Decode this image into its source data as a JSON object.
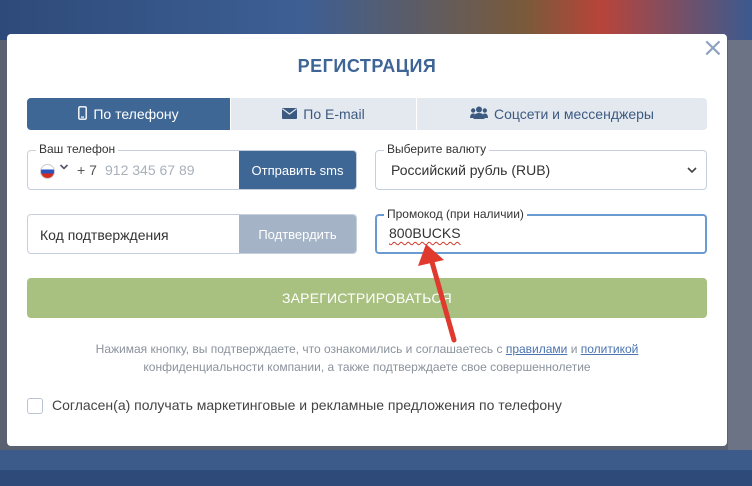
{
  "modal": {
    "title": "РЕГИСТРАЦИЯ",
    "close_icon": "close-icon"
  },
  "tabs": [
    {
      "label": "По телефону",
      "icon": "phone-icon",
      "active": true
    },
    {
      "label": "По E-mail",
      "icon": "envelope-icon",
      "active": false
    },
    {
      "label": "Соцсети и мессенджеры",
      "icon": "users-icon",
      "active": false
    }
  ],
  "phone": {
    "label": "Ваш телефон",
    "country_code": "+ 7",
    "placeholder": "912 345 67 89",
    "flag_icon": "russia-flag-icon",
    "send_sms_label": "Отправить sms"
  },
  "currency": {
    "label": "Выберите валюту",
    "value": "Российский рубль (RUB)"
  },
  "code": {
    "placeholder": "Код подтверждения",
    "confirm_label": "Подтвердить"
  },
  "promo": {
    "label": "Промокод (при наличии)",
    "value": "800BUCKS"
  },
  "register_label": "ЗАРЕГИСТРИРОВАТЬСЯ",
  "terms": {
    "text_before": "Нажимая кнопку, вы подтверждаете, что ознакомились и соглашаетесь с ",
    "rules_link": "правилами",
    "and": " и ",
    "policy_link": "политикой",
    "text_after": " конфиденциальности компании, а также подтверждаете свое совершеннолетие"
  },
  "marketing_checkbox": {
    "label": "Согласен(а) получать маркетинговые и рекламные предложения по телефону",
    "checked": false
  },
  "colors": {
    "primary": "#3f6796",
    "register_button": "#a8c080",
    "arrow": "#e0392e"
  }
}
